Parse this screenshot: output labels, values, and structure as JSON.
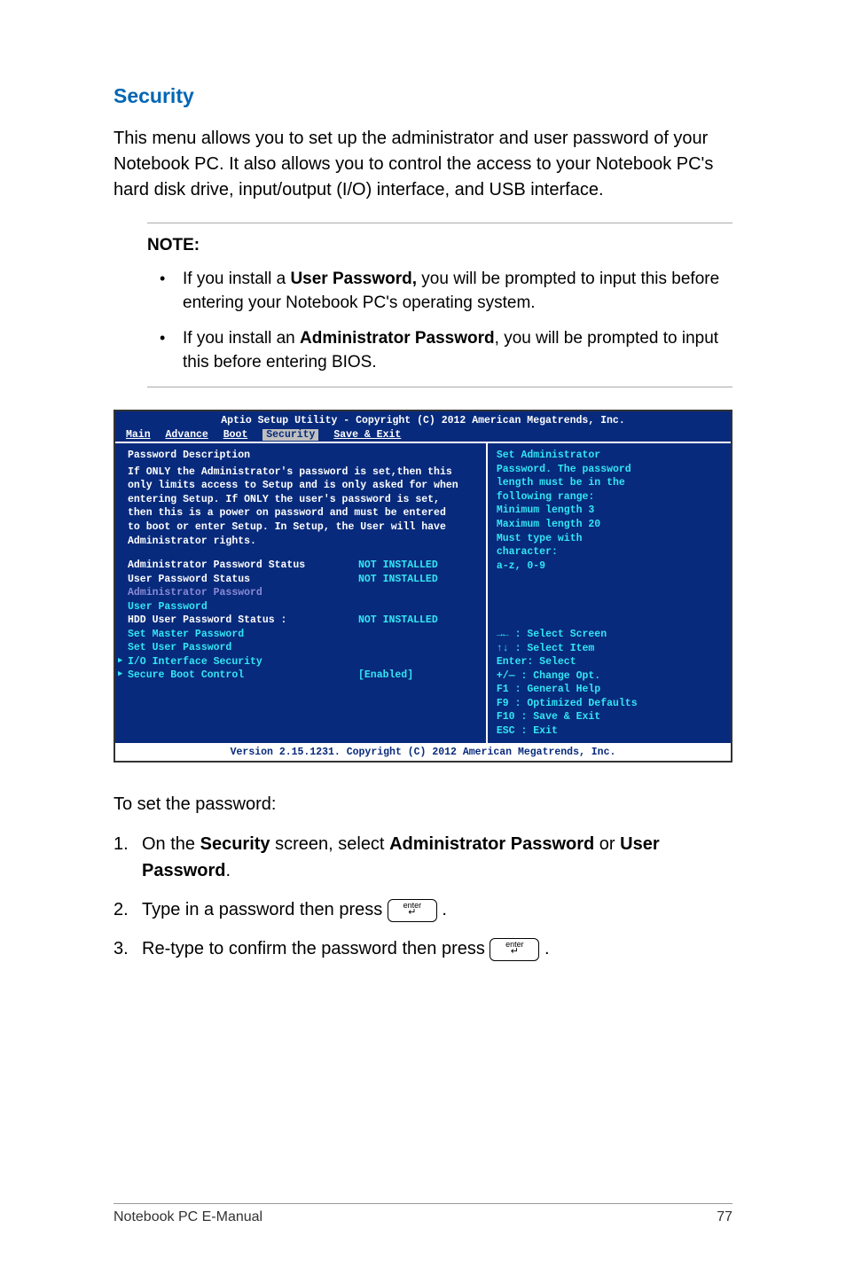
{
  "heading": "Security",
  "intro": "This menu allows you to set up the administrator and user password of your Notebook PC. It also allows you to control the access to your Notebook PC's hard disk drive, input/output (I/O) interface, and USB interface.",
  "note": {
    "label": "NOTE:",
    "items": [
      {
        "prefix": "If you install a ",
        "bold": "User Password,",
        "suffix": " you will be prompted to input this before entering your Notebook PC's operating system."
      },
      {
        "prefix": "If you install an ",
        "bold": "Administrator Password",
        "suffix": ", you will be prompted to input this before entering BIOS."
      }
    ]
  },
  "bios": {
    "title": "Aptio Setup Utility - Copyright (C) 2012 American Megatrends, Inc.",
    "tabs": [
      "Main",
      "Advance",
      "Boot",
      "Security",
      "Save & Exit"
    ],
    "active_tab": "Security",
    "left": {
      "pd_heading": "Password Description",
      "desc1": "If ONLY the Administrator's password is set,then this",
      "desc2": "only limits access to Setup and is only asked for when",
      "desc3": "entering Setup. If ONLY the user's password is set,",
      "desc4": "then this is a power on password and must be entered",
      "desc5": "to boot or enter Setup. In Setup, the User will have",
      "desc6": "Administrator rights.",
      "admin_status_label": "Administrator Password Status",
      "admin_status_val": "NOT INSTALLED",
      "user_status_label": "User Password Status",
      "user_status_val": "NOT INSTALLED",
      "admin_pw": "Administrator Password",
      "user_pw": "User Password",
      "hdd_status_label": "HDD User Password Status :",
      "hdd_status_val": "NOT INSTALLED",
      "set_master": "Set Master Password",
      "set_user": "Set User Password",
      "io_sec": "I/O Interface Security",
      "secure_boot_label": "Secure Boot Control",
      "secure_boot_val": "[Enabled]"
    },
    "right": {
      "help1": "Set Administrator",
      "help2": "Password. The password",
      "help3": "length must be in the",
      "help4": "following range:",
      "help5": "Minimum length 3",
      "help6": "Maximum length 20",
      "help7": "Must type with",
      "help8": "character:",
      "help9": "a-z, 0-9",
      "hint1": "→←   : Select Screen",
      "hint2": "↑↓   : Select Item",
      "hint3": "Enter: Select",
      "hint4": "+/—  : Change Opt.",
      "hint5": "F1   : General Help",
      "hint6": "F9   : Optimized Defaults",
      "hint7": "F10  : Save & Exit",
      "hint8": "ESC  : Exit"
    },
    "footer": "Version 2.15.1231. Copyright (C) 2012 American Megatrends, Inc."
  },
  "instructions": {
    "lead": "To set the password:",
    "step1": {
      "num": "1.",
      "p1": "On the ",
      "b1": "Security",
      "p2": " screen, select ",
      "b2": "Administrator Password",
      "p3": " or ",
      "b3": "User Password",
      "p4": "."
    },
    "step2": {
      "num": "2.",
      "text": "Type in a password then press "
    },
    "step3": {
      "num": "3.",
      "text": "Re-type to confirm the password then press "
    }
  },
  "footer": {
    "left": "Notebook PC E-Manual",
    "right": "77"
  }
}
